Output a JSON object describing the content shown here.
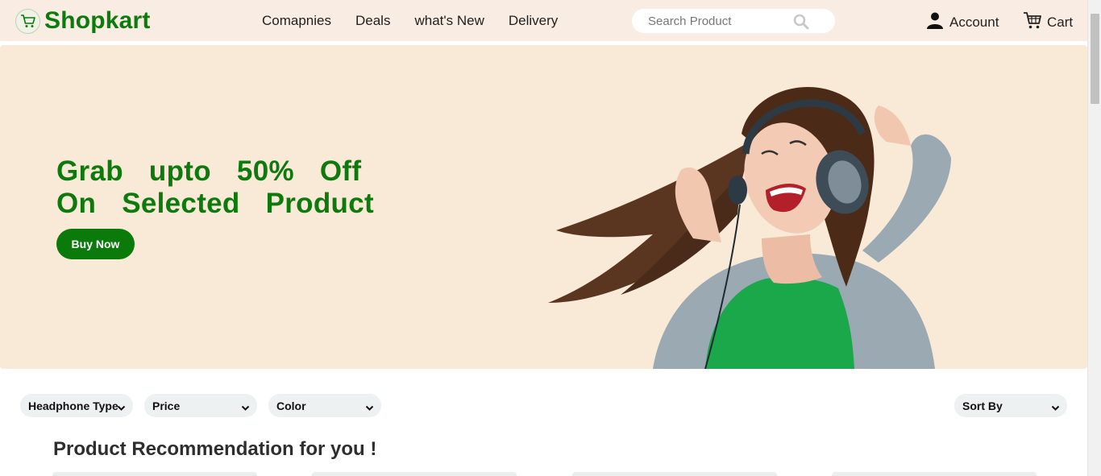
{
  "brand": {
    "name": "Shopkart",
    "logo_icon": "cart-icon"
  },
  "nav": {
    "links": [
      "Comapnies",
      "Deals",
      "what's New",
      "Delivery"
    ]
  },
  "search": {
    "placeholder": "Search Product",
    "icon": "search-icon"
  },
  "account": {
    "label": "Account",
    "icon": "user-icon"
  },
  "cart": {
    "label": "Cart",
    "icon": "cart-icon"
  },
  "hero": {
    "line1": "Grab upto 50% Off",
    "line2": "On Selected Product",
    "cta": "Buy Now"
  },
  "filters": {
    "headphone_type": "Headphone Type",
    "price": "Price",
    "color": "Color",
    "sort_by": "Sort By"
  },
  "section": {
    "title": "Product Recommendation for you !"
  },
  "colors": {
    "accent": "#0a7a0a",
    "nav_bg": "#f9ece2",
    "hero_bg": "#f9e9d7"
  }
}
